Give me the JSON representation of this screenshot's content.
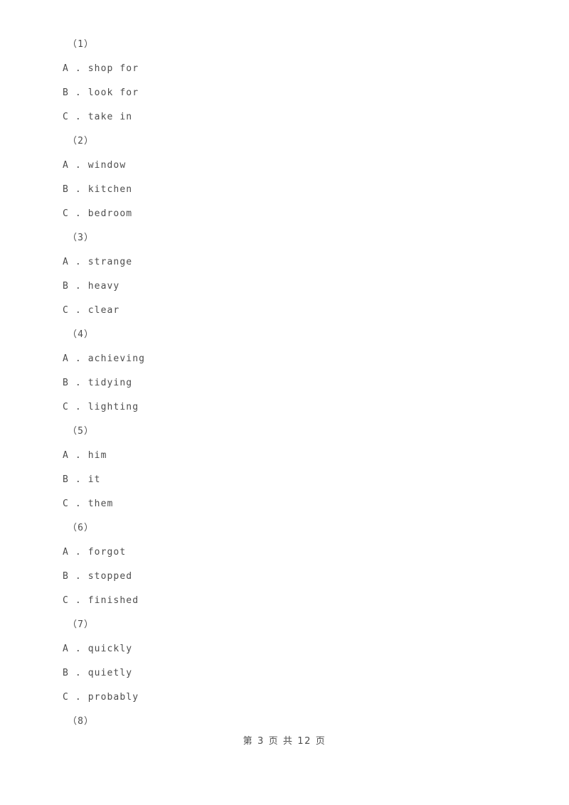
{
  "page": {
    "background_color": "#ffffff",
    "text_color": "#4d4d4d"
  },
  "questions": [
    {
      "number": "（1）",
      "options": [
        {
          "letter": "A",
          "separator": " . ",
          "text": "shop for"
        },
        {
          "letter": "B",
          "separator": " . ",
          "text": "look for"
        },
        {
          "letter": "C",
          "separator": " . ",
          "text": "take in"
        }
      ]
    },
    {
      "number": "（2）",
      "options": [
        {
          "letter": "A",
          "separator": " . ",
          "text": "window"
        },
        {
          "letter": "B",
          "separator": " . ",
          "text": "kitchen"
        },
        {
          "letter": "C",
          "separator": " . ",
          "text": "bedroom"
        }
      ]
    },
    {
      "number": "（3）",
      "options": [
        {
          "letter": "A",
          "separator": " . ",
          "text": "strange"
        },
        {
          "letter": "B",
          "separator": " . ",
          "text": "heavy"
        },
        {
          "letter": "C",
          "separator": " . ",
          "text": "clear"
        }
      ]
    },
    {
      "number": "（4）",
      "options": [
        {
          "letter": "A",
          "separator": " . ",
          "text": "achieving"
        },
        {
          "letter": "B",
          "separator": " . ",
          "text": "tidying"
        },
        {
          "letter": "C",
          "separator": " . ",
          "text": "lighting"
        }
      ]
    },
    {
      "number": "（5）",
      "options": [
        {
          "letter": "A",
          "separator": " . ",
          "text": "him"
        },
        {
          "letter": "B",
          "separator": " . ",
          "text": "it"
        },
        {
          "letter": "C",
          "separator": " . ",
          "text": "them"
        }
      ]
    },
    {
      "number": "（6）",
      "options": [
        {
          "letter": "A",
          "separator": " . ",
          "text": "forgot"
        },
        {
          "letter": "B",
          "separator": " . ",
          "text": "stopped"
        },
        {
          "letter": "C",
          "separator": " . ",
          "text": "finished"
        }
      ]
    },
    {
      "number": "（7）",
      "options": [
        {
          "letter": "A",
          "separator": " . ",
          "text": "quickly"
        },
        {
          "letter": "B",
          "separator": " . ",
          "text": "quietly"
        },
        {
          "letter": "C",
          "separator": " . ",
          "text": "probably"
        }
      ]
    },
    {
      "number": "（8）",
      "options": []
    }
  ],
  "footer": {
    "text": "第 3 页 共 12 页",
    "current_page": "3",
    "total_pages": "12"
  }
}
